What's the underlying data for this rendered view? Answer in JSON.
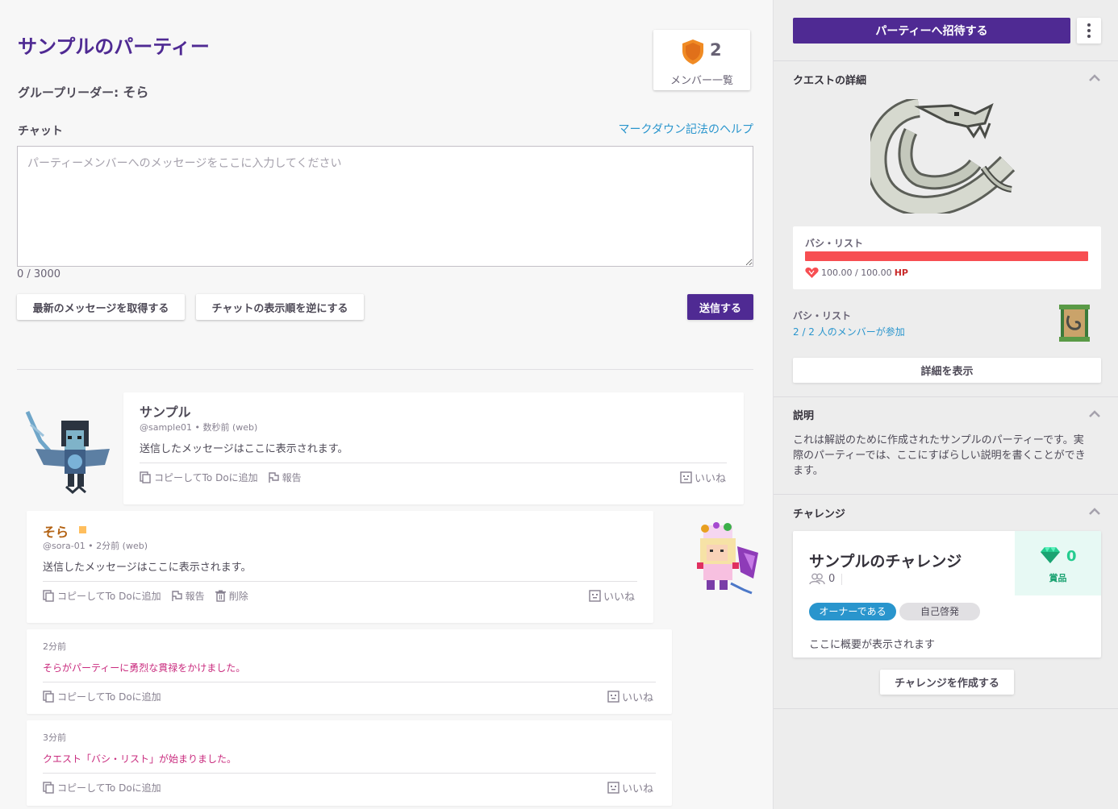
{
  "party": {
    "title": "サンプルのパーティー",
    "leader_label": "グループリーダー: ",
    "leader_name": "そら",
    "member_count": "2",
    "member_list_label": "メンバー一覧"
  },
  "chat": {
    "label": "チャット",
    "markdown_help": "マークダウン記法のヘルプ",
    "placeholder": "パーティーメンバーへのメッセージをここに入力してください",
    "value": "",
    "char_count": "0 / 3000",
    "fetch_button": "最新のメッセージを取得する",
    "reverse_button": "チャットの表示順を逆にする",
    "send_button": "送信する"
  },
  "messages": [
    {
      "author": "サンプル",
      "meta": "@sample01 • 数秒前 (web)",
      "text": "送信したメッセージはここに表示されます。",
      "copy_label": "コピーしてTo Doに追加",
      "report_label": "報告",
      "like_label": "いいね"
    },
    {
      "author": "そら",
      "meta": "@sora-01 • 2分前 (web)",
      "text": "送信したメッセージはここに表示されます。",
      "copy_label": "コピーしてTo Doに追加",
      "report_label": "報告",
      "delete_label": "削除",
      "like_label": "いいね"
    }
  ],
  "system_messages": [
    {
      "time": "2分前",
      "text": "そらがパーティーに勇烈な貫禄をかけました。",
      "copy_label": "コピーしてTo Doに追加",
      "like_label": "いいね"
    },
    {
      "time": "3分前",
      "text": "クエスト「バシ・リスト」が始まりました。",
      "copy_label": "コピーしてTo Doに追加",
      "like_label": "いいね"
    }
  ],
  "sidebar": {
    "invite_button": "パーティーへ招待する",
    "quest": {
      "section_title": "クエストの詳細",
      "boss_name": "バシ・リスト",
      "hp_text": "100.00 / 100.00",
      "hp_unit": "HP",
      "hp_fraction": 1.0,
      "quest_name": "バシ・リスト",
      "members_joined": "2 / 2 人のメンバーが参加",
      "details_button": "詳細を表示"
    },
    "description": {
      "section_title": "説明",
      "text": "これは解説のために作成されたサンプルのパーティーです。実際のパーティーでは、ここにすばらしい説明を書くことができます。"
    },
    "challenges": {
      "section_title": "チャレンジ",
      "card": {
        "name": "サンプルのチャレンジ",
        "member_count": "0",
        "prize_value": "0",
        "prize_label": "賞品",
        "owner_tag": "オーナーである",
        "category_tag": "自己啓発",
        "summary": "ここに概要が表示されます"
      },
      "create_button": "チャレンジを作成する"
    }
  },
  "colors": {
    "brand_purple": "#4f2a93",
    "link_blue": "#2995cd",
    "hp_red": "#f74e52",
    "system_pink": "#c92b7e",
    "leader_gold": "#b36213",
    "gem_green": "#24cc8f"
  }
}
